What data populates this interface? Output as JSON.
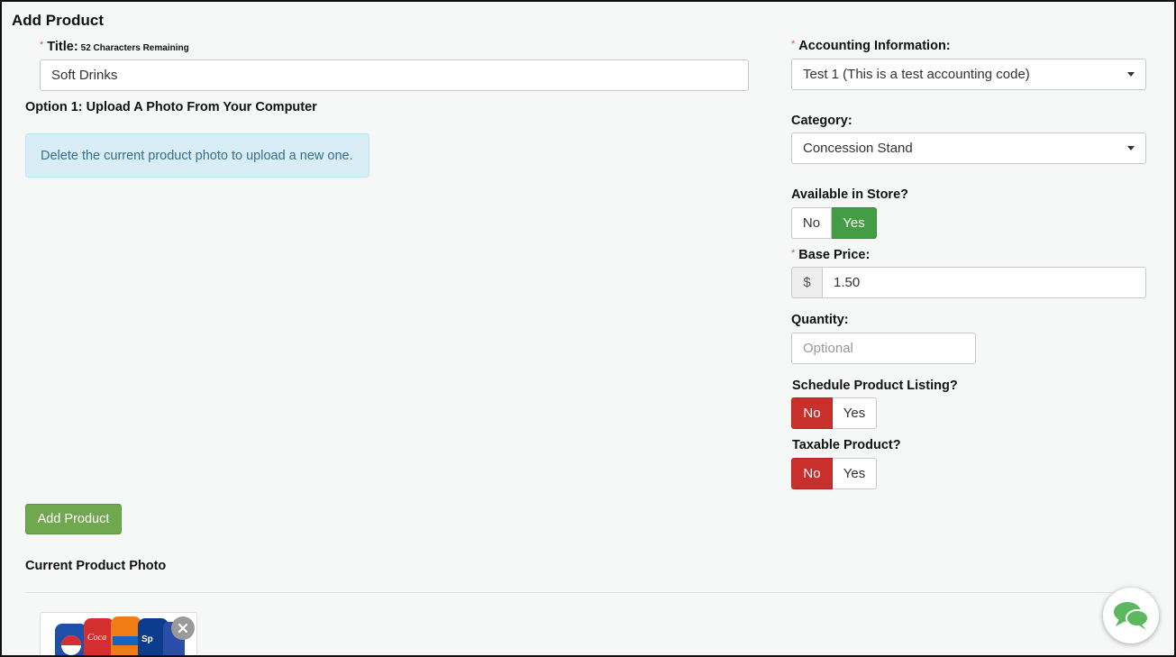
{
  "page": {
    "title": "Add Product"
  },
  "title_field": {
    "label": "Title:",
    "required_mark": "*",
    "chars_remaining": "52 Characters Remaining",
    "value": "Soft Drinks"
  },
  "upload": {
    "heading": "Option 1: Upload A Photo From Your Computer",
    "notice": "Delete the current product photo to upload a new one."
  },
  "accounting": {
    "label": "Accounting Information:",
    "required_mark": "*",
    "selected": "Test 1 (This is a test accounting code)"
  },
  "category": {
    "label": "Category:",
    "selected": "Concession Stand"
  },
  "available_in_store": {
    "label": "Available in Store?",
    "no_label": "No",
    "yes_label": "Yes",
    "selected": "Yes"
  },
  "base_price": {
    "label": "Base Price:",
    "required_mark": "*",
    "currency_symbol": "$",
    "value": "1.50"
  },
  "quantity": {
    "label": "Quantity:",
    "placeholder": "Optional"
  },
  "schedule_listing": {
    "label": "Schedule Product Listing?",
    "no_label": "No",
    "yes_label": "Yes",
    "selected": "No"
  },
  "taxable": {
    "label": "Taxable Product?",
    "no_label": "No",
    "yes_label": "Yes",
    "selected": "No"
  },
  "actions": {
    "add_product_label": "Add Product"
  },
  "current_photo": {
    "heading": "Current Product Photo"
  },
  "colors": {
    "success_green": "#449d44",
    "danger_red": "#c9302c",
    "primary_button": "#6fa84f",
    "info_bg": "#d9edf7",
    "info_text": "#31708f",
    "chat_icon": "#5cb85c"
  },
  "icons": {
    "dropdown": "caret-down-icon",
    "photo_remove": "close-circle-icon",
    "chat": "chat-bubbles-icon"
  }
}
